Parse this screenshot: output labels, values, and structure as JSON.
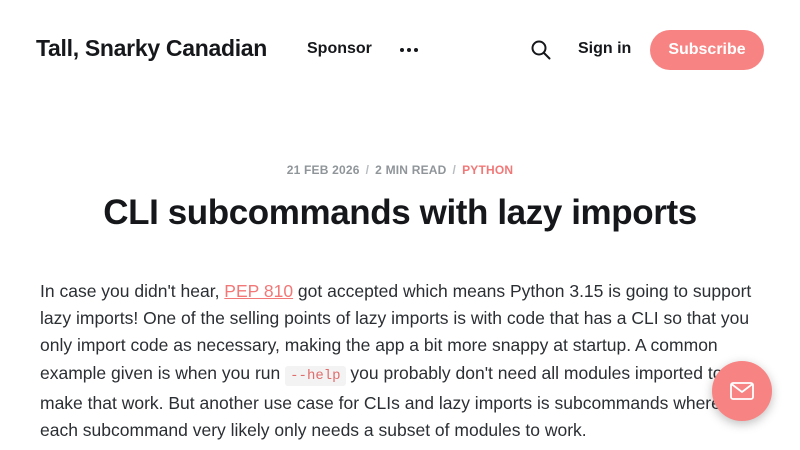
{
  "header": {
    "site_title": "Tall, Snarky Canadian",
    "nav_sponsor": "Sponsor",
    "more_icon": "more-horizontal-icon",
    "search_icon": "search-icon",
    "sign_in": "Sign in",
    "subscribe": "Subscribe"
  },
  "post": {
    "date": "21 FEB 2026",
    "separator": "/",
    "read_time": "2 MIN READ",
    "tag": "PYTHON",
    "title": "CLI subcommands with lazy imports",
    "body": {
      "p1_before_link": "In case you didn't hear, ",
      "pep_link": "PEP 810",
      "p1_after_link": " got accepted which means Python 3.15 is going to support lazy imports! One of the selling points of lazy imports is with code that has a CLI so that you only import code as necessary, making the app a bit more snappy at startup. A common example given is when you run ",
      "code_help": "--help",
      "p1_after_code": " you probably don't need all modules imported to make that work. But another use case for CLIs and lazy imports is subcommands where each subcommand very likely only needs a subset of modules to work."
    }
  },
  "fab": {
    "icon": "envelope-icon"
  },
  "colors": {
    "accent": "#f88383",
    "tag": "#f27878",
    "text": "#15171a",
    "meta": "#8f9599"
  }
}
